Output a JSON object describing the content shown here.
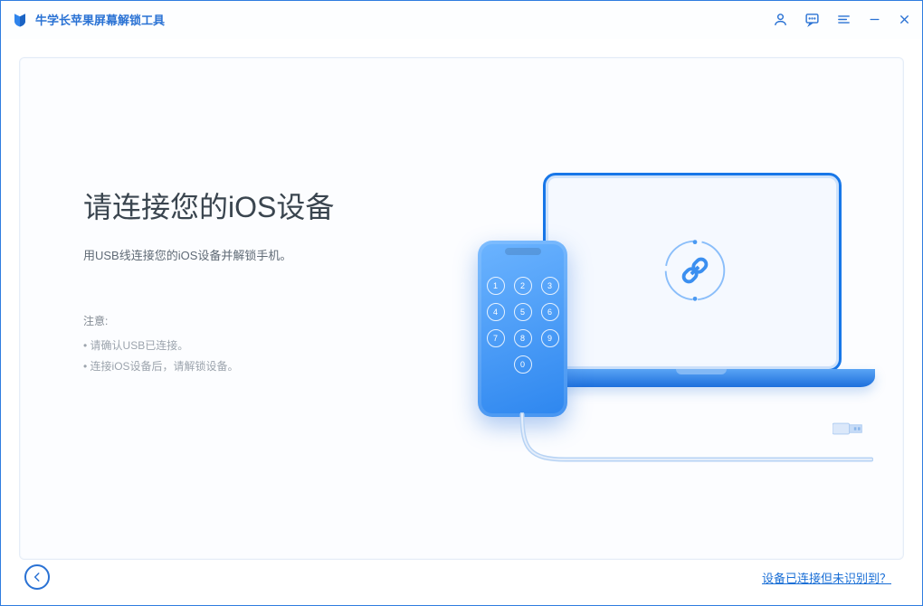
{
  "app": {
    "title": "牛学长苹果屏幕解锁工具"
  },
  "main": {
    "heading": "请连接您的iOS设备",
    "subtext": "用USB线连接您的iOS设备并解锁手机。",
    "note_title": "注意:",
    "note_1": "请确认USB已连接。",
    "note_2": "连接iOS设备后，请解锁设备。"
  },
  "keypad": {
    "k1": "1",
    "k2": "2",
    "k3": "3",
    "k4": "4",
    "k5": "5",
    "k6": "6",
    "k7": "7",
    "k8": "8",
    "k9": "9",
    "k0": "0"
  },
  "footer": {
    "help_link": "设备已连接但未识别到？"
  }
}
